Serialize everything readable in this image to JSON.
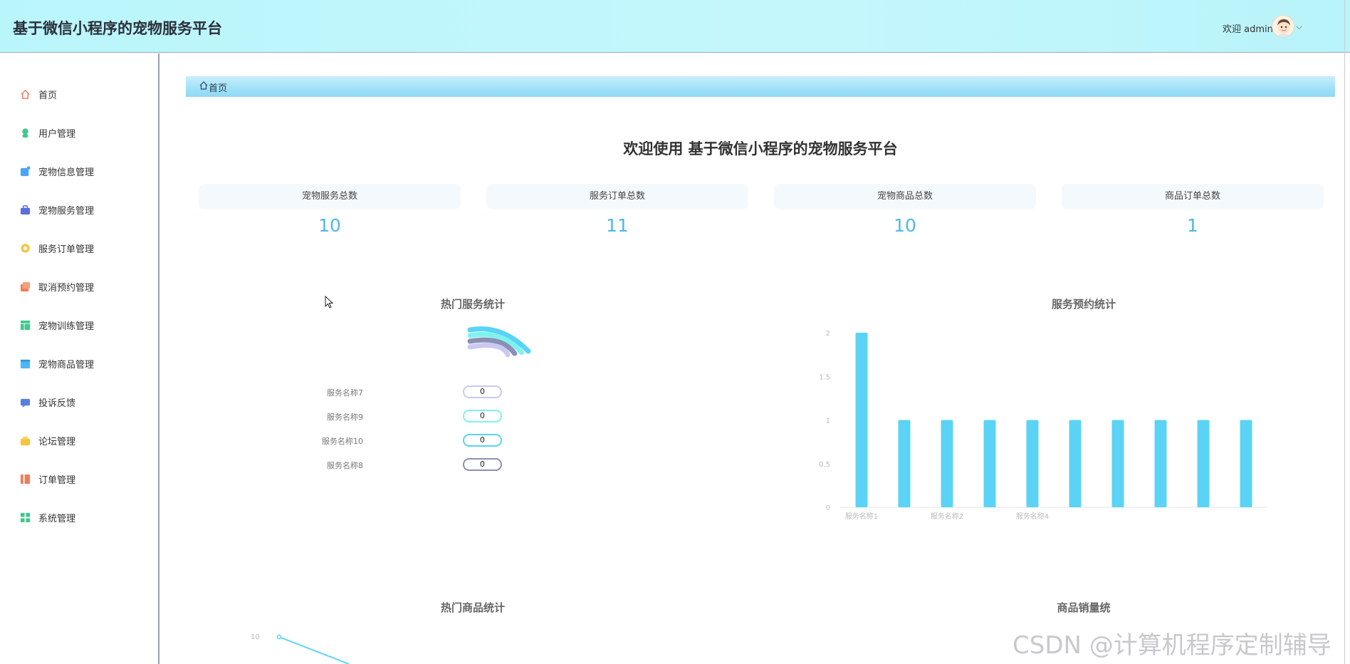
{
  "header": {
    "app_title": "基于微信小程序的宠物服务平台",
    "welcome_text": "欢迎 admin"
  },
  "sidebar": {
    "items": [
      {
        "label": "首页",
        "icon": "home-icon",
        "color": "#f07c5a"
      },
      {
        "label": "用户管理",
        "icon": "user-icon",
        "color": "#3fc98b"
      },
      {
        "label": "宠物信息管理",
        "icon": "pet-info-icon",
        "color": "#4aa6f5"
      },
      {
        "label": "宠物服务管理",
        "icon": "pet-service-icon",
        "color": "#5a6ee0"
      },
      {
        "label": "服务订单管理",
        "icon": "service-order-icon",
        "color": "#f5c43a"
      },
      {
        "label": "取消预约管理",
        "icon": "cancel-booking-icon",
        "color": "#f07c5a"
      },
      {
        "label": "宠物训练管理",
        "icon": "training-icon",
        "color": "#3fc98b"
      },
      {
        "label": "宠物商品管理",
        "icon": "product-icon",
        "color": "#4ab8f5"
      },
      {
        "label": "投诉反馈",
        "icon": "feedback-icon",
        "color": "#5a7ee0"
      },
      {
        "label": "论坛管理",
        "icon": "forum-icon",
        "color": "#f5c43a"
      },
      {
        "label": "订单管理",
        "icon": "order-icon",
        "color": "#f07c5a"
      },
      {
        "label": "系统管理",
        "icon": "system-icon",
        "color": "#3fc98b"
      }
    ]
  },
  "breadcrumb": {
    "label": "首页"
  },
  "main": {
    "headline": "欢迎使用 基于微信小程序的宠物服务平台",
    "stats": [
      {
        "title": "宠物服务总数",
        "value": "10"
      },
      {
        "title": "服务订单总数",
        "value": "11"
      },
      {
        "title": "宠物商品总数",
        "value": "10"
      },
      {
        "title": "商品订单总数",
        "value": "1"
      }
    ]
  },
  "chart_data": [
    {
      "type": "gauge",
      "title": "热门服务统计",
      "series": [
        {
          "name": "服务名称7",
          "value": 0,
          "color": "#c9c9f2"
        },
        {
          "name": "服务名称9",
          "value": 0,
          "color": "#7ff2ee"
        },
        {
          "name": "服务名称10",
          "value": 0,
          "color": "#5ad3f5"
        },
        {
          "name": "服务名称8",
          "value": 0,
          "color": "#8a8fb6"
        }
      ]
    },
    {
      "type": "bar",
      "title": "服务预约统计",
      "categories": [
        "服务名称1",
        "",
        "服务名称2",
        "",
        "服务名称4",
        "",
        "",
        "",
        "",
        ""
      ],
      "values": [
        2,
        1,
        1,
        1,
        1,
        1,
        1,
        1,
        1,
        1
      ],
      "yticks": [
        "0",
        "0.5",
        "1",
        "1.5",
        "2"
      ],
      "ylim": [
        0,
        2
      ],
      "color": "#5ad3f5"
    },
    {
      "type": "line",
      "title": "热门商品统计",
      "yticks": [
        "10"
      ],
      "color": "#5ad3f5"
    },
    {
      "type": "bar",
      "title": "商品销量统"
    }
  ],
  "watermark": "CSDN @计算机程序定制辅导"
}
